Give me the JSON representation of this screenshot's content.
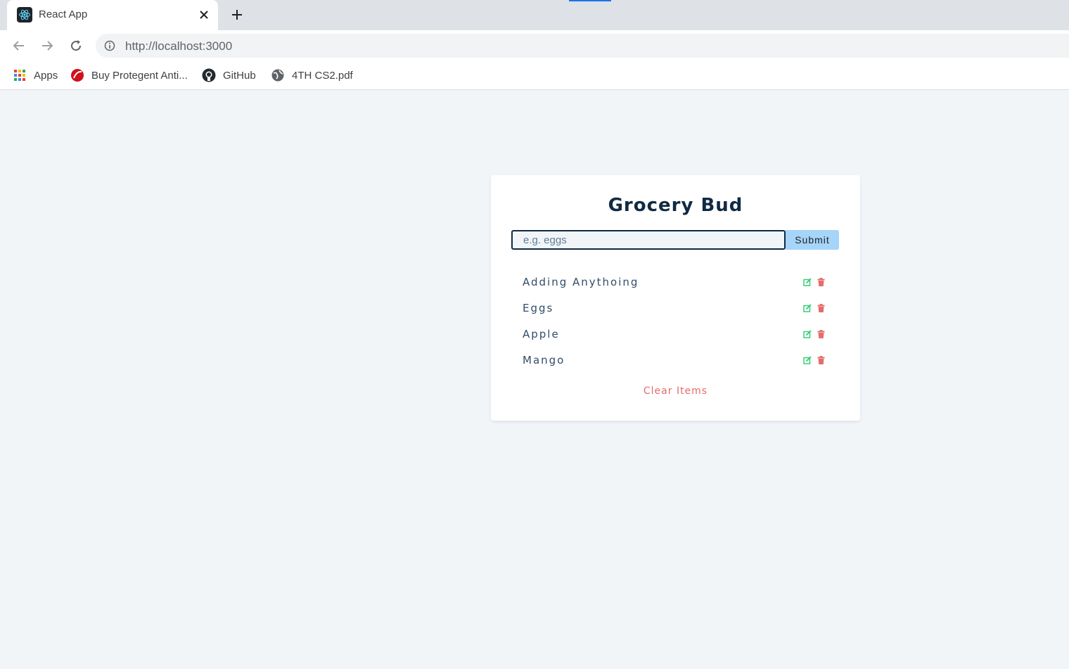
{
  "browser": {
    "tab_title": "React App",
    "url": "http://localhost:3000",
    "bookmarks": [
      {
        "label": "Apps",
        "icon": "apps-grid-icon"
      },
      {
        "label": "Buy Protegent Anti...",
        "icon": "protegent-icon"
      },
      {
        "label": "GitHub",
        "icon": "github-icon"
      },
      {
        "label": "4TH CS2.pdf",
        "icon": "globe-icon"
      }
    ]
  },
  "app": {
    "title": "Grocery Bud",
    "input_placeholder": "e.g. eggs",
    "input_value": "",
    "submit_label": "Submit",
    "items": [
      {
        "title": "Adding Anythoing"
      },
      {
        "title": "Eggs"
      },
      {
        "title": "Apple"
      },
      {
        "title": "Mango"
      }
    ],
    "clear_label": "Clear Items"
  },
  "colors": {
    "page_bg": "#f1f5f8",
    "title": "#102a42",
    "submit_bg": "#a5d5f8",
    "edit_icon": "#2ecc71",
    "delete_icon": "#e66b6b",
    "clear_text": "#e66b6b"
  }
}
